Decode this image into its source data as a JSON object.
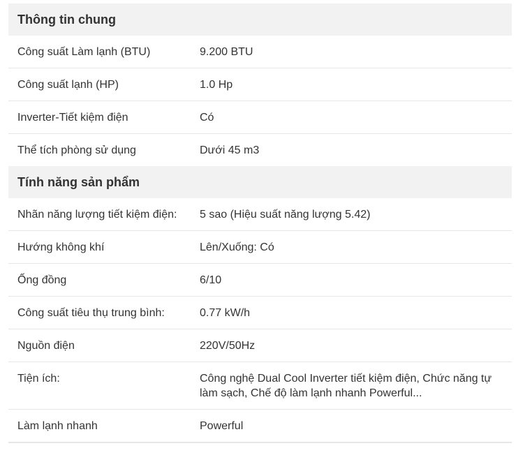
{
  "groups": [
    {
      "title": "Thông tin chung",
      "rows": [
        {
          "label": "Công suất Làm lạnh (BTU)",
          "value": "9.200 BTU"
        },
        {
          "label": "Công suất lạnh (HP)",
          "value": "1.0 Hp"
        },
        {
          "label": "Inverter-Tiết kiệm điện",
          "value": "Có"
        },
        {
          "label": "Thể tích phòng sử dụng",
          "value": "Dưới 45 m3"
        }
      ]
    },
    {
      "title": "Tính năng sản phẩm",
      "rows": [
        {
          "label": "Nhãn năng lượng tiết kiệm điện:",
          "value": "5 sao (Hiệu suất năng lượng 5.42)"
        },
        {
          "label": "Hướng không khí",
          "value": "Lên/Xuống: Có"
        },
        {
          "label": "Ống đồng",
          "value": "6/10"
        },
        {
          "label": "Công suất tiêu thụ trung bình:",
          "value": "0.77 kW/h"
        },
        {
          "label": "Nguồn điện",
          "value": "220V/50Hz"
        },
        {
          "label": "Tiện ích:",
          "value": "Công nghệ Dual Cool Inverter tiết kiệm điện, Chức năng tự làm sạch, Chế độ làm lạnh nhanh Powerful..."
        },
        {
          "label": "Làm lạnh nhanh",
          "value": "Powerful"
        }
      ]
    }
  ]
}
